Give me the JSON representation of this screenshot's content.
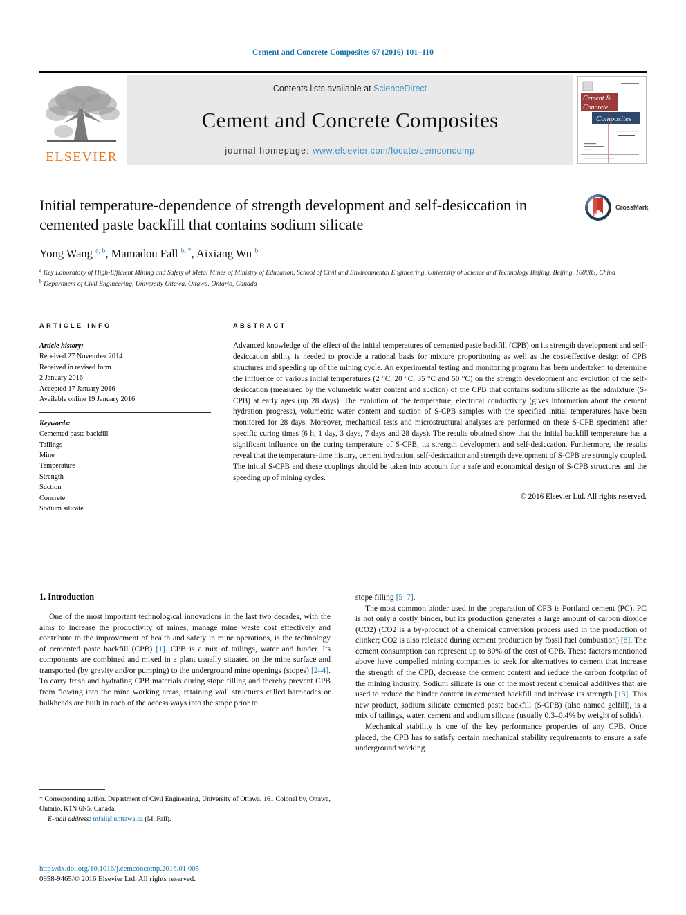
{
  "running_head": "Cement and Concrete Composites 67 (2016) 101–110",
  "masthead": {
    "publisher_name": "ELSEVIER",
    "contents_prefix": "Contents lists available at ",
    "contents_link": "ScienceDirect",
    "journal_title": "Cement and Concrete Composites",
    "homepage_prefix": "journal homepage: ",
    "homepage_url": "www.elsevier.com/locate/cemconcomp",
    "cover": {
      "line1": "Cement &",
      "line2": "Concrete",
      "line3": "Composites"
    }
  },
  "article": {
    "title": "Initial temperature-dependence of strength development and self-desiccation in cemented paste backfill that contains sodium silicate",
    "authors_html": "Yong Wang <sup>a, b</sup>, Mamadou Fall <sup>b, *</sup>, Aixiang Wu <sup>b</sup>",
    "affiliation_a": "Key Laboratory of High-Efficient Mining and Safety of Metal Mines of Ministry of Education, School of Civil and Environmental Engineering, University of Science and Technology Beijing, Beijing, 100083, China",
    "affiliation_b": "Department of Civil Engineering, University Ottawa, Ottawa, Ontario, Canada",
    "crossmark_label": "CrossMark"
  },
  "sections": {
    "article_info_heading": "ARTICLE INFO",
    "abstract_heading": "ABSTRACT"
  },
  "article_info": {
    "history_label": "Article history:",
    "history_lines": [
      "Received 27 November 2014",
      "Received in revised form",
      "2 January 2016",
      "Accepted 17 January 2016",
      "Available online 19 January 2016"
    ],
    "keywords_label": "Keywords:",
    "keywords": [
      "Cemented paste backfill",
      "Tailings",
      "Mine",
      "Temperature",
      "Strength",
      "Suction",
      "Concrete",
      "Sodium silicate"
    ]
  },
  "abstract": {
    "text": "Advanced knowledge of the effect of the initial temperatures of cemented paste backfill (CPB) on its strength development and self-desiccation ability is needed to provide a rational basis for mixture proportioning as well as the cost-effective design of CPB structures and speeding up of the mining cycle. An experimental testing and monitoring program has been undertaken to determine the influence of various initial temperatures (2 °C, 20 °C, 35 °C and 50 °C) on the strength development and evolution of the self-desiccation (measured by the volumetric water content and suction) of the CPB that contains sodium silicate as the admixture (S-CPB) at early ages (up 28 days). The evolution of the temperature, electrical conductivity (gives information about the cement hydration progress), volumetric water content and suction of S-CPB samples with the specified initial temperatures have been monitored for 28 days. Moreover, mechanical tests and microstructural analyses are performed on these S-CPB specimens after specific curing times (6 h, 1 day, 3 days, 7 days and 28 days). The results obtained show that the initial backfill temperature has a significant influence on the curing temperature of S-CPB, its strength development and self-desiccation. Furthermore, the results reveal that the temperature-time history, cement hydration, self-desiccation and strength development of S-CPB are strongly coupled. The initial S-CPB and these couplings should be taken into account for a safe and economical design of S-CPB structures and the speeding up of mining cycles.",
    "copyright": "© 2016 Elsevier Ltd. All rights reserved."
  },
  "introduction": {
    "heading": "1. Introduction",
    "left_para_1_a": "One of the most important technological innovations in the last two decades, with the aims to increase the productivity of mines, manage mine waste cost effectively and contribute to the improvement of health and safety in mine operations, is the technology of cemented paste backfill (CPB) ",
    "left_ref_1": "[1]",
    "left_para_1_b": ". CPB is a mix of tailings, water and binder. Its components are combined and mixed in a plant usually situated on the mine surface and transported (by gravity and/or pumping) to the underground mine openings (stopes) ",
    "left_ref_2": "[2–4]",
    "left_para_1_c": ". To carry fresh and hydrating CPB materials during stope filling and thereby prevent CPB from flowing into the mine working areas, retaining wall structures called barricades or bulkheads are built in each of the access ways into the stope prior to",
    "right_cont_a": "stope filling ",
    "right_ref_5": "[5–7]",
    "right_cont_b": ".",
    "right_para_2_a": "The most common binder used in the preparation of CPB is Portland cement (PC). PC is not only a costly binder, but its production generates a large amount of carbon dioxide (CO2) (CO2 is a by-product of a chemical conversion process used in the production of clinker; CO2 is also released during cement production by fossil fuel combustion) ",
    "right_ref_8": "[8]",
    "right_para_2_b": ". The cement consumption can represent up to 80% of the cost of CPB. These factors mentioned above have compelled mining companies to seek for alternatives to cement that increase the strength of the CPB, decrease the cement content and reduce the carbon footprint of the mining industry. Sodium silicate is one of the most recent chemical additives that are used to reduce the binder content in cemented backfill and increase its strength ",
    "right_ref_13": "[13]",
    "right_para_2_c": ". This new product, sodium silicate cemented paste backfill (S-CPB) (also named gelfill), is a mix of tailings, water, cement and sodium silicate (usually 0.3–0.4% by weight of solids).",
    "right_para_3": "Mechanical stability is one of the key performance properties of any CPB. Once placed, the CPB has to satisfy certain mechanical stability requirements to ensure a safe underground working"
  },
  "footnote": {
    "corresponding": "* Corresponding author. Department of Civil Engineering, University of Ottawa, 161 Colonel by, Ottawa, Ontario, K1N 6N5, Canada.",
    "email_label": "E-mail address:",
    "email": "mfall@uottawa.ca",
    "email_suffix": "(M. Fall)."
  },
  "doi": {
    "url": "http://dx.doi.org/10.1016/j.cemconcomp.2016.01.005",
    "issn_line": "0958-9465/© 2016 Elsevier Ltd. All rights reserved."
  },
  "colors": {
    "link": "#1271a8",
    "elsevier_orange": "#e87722",
    "sciencedirect_blue": "#3a8fc4",
    "cover_red": "#9c3b3b",
    "cover_navy": "#2e4a6b"
  }
}
